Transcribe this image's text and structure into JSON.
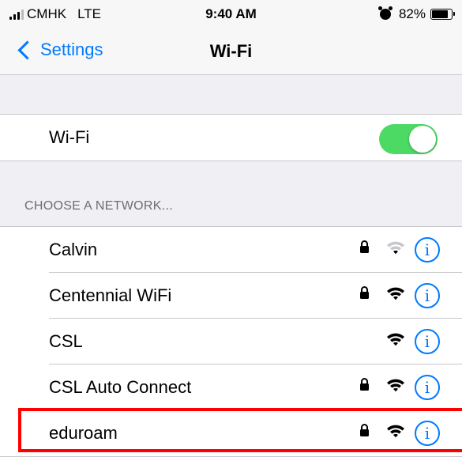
{
  "status_bar": {
    "carrier": "CMHK",
    "network": "LTE",
    "time": "9:40 AM",
    "battery_percent": "82%",
    "battery_level": 0.82
  },
  "nav": {
    "back_label": "Settings",
    "title": "Wi-Fi"
  },
  "wifi_toggle": {
    "label": "Wi-Fi",
    "on": true,
    "color": "#4cd964"
  },
  "section_header": "CHOOSE A NETWORK...",
  "networks": [
    {
      "name": "Calvin",
      "secured": true,
      "signal": "low"
    },
    {
      "name": "Centennial WiFi",
      "secured": true,
      "signal": "full"
    },
    {
      "name": "CSL",
      "secured": false,
      "signal": "full"
    },
    {
      "name": "CSL Auto Connect",
      "secured": true,
      "signal": "full"
    },
    {
      "name": "eduroam",
      "secured": true,
      "signal": "full",
      "highlighted": true
    }
  ],
  "info_glyph": "i",
  "colors": {
    "accent": "#007aff",
    "highlight": "#ff0000"
  }
}
